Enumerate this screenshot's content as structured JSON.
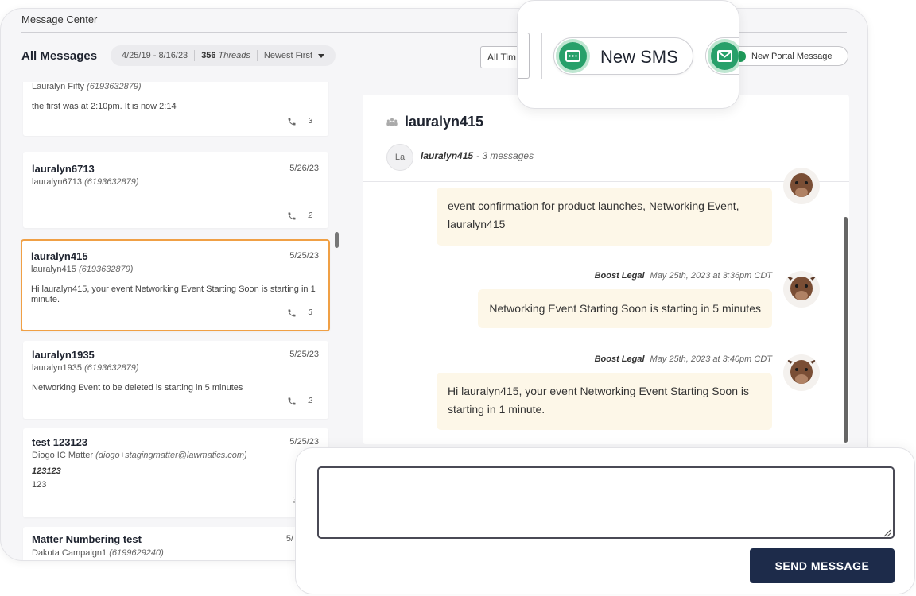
{
  "app": {
    "title": "Message Center"
  },
  "header": {
    "heading": "All Messages",
    "date_range": "4/25/19 - 8/16/23",
    "thread_count": "356",
    "thread_label": "Threads",
    "sort": "Newest First",
    "time_filter": "All Tim",
    "new_sms_label": "New SMS",
    "new_portal_label": "New Portal Message"
  },
  "threads": [
    {
      "name": "",
      "date": "",
      "sub_name": "Lauralyn Fifty",
      "sub_phone": "(6193632879)",
      "preview": "the first was at 2:10pm. It is now 2:14",
      "count": "3",
      "icon": "phone-icon"
    },
    {
      "name": "lauralyn6713",
      "date": "5/26/23",
      "sub_name": "lauralyn6713",
      "sub_phone": "(6193632879)",
      "preview": "",
      "count": "2",
      "icon": "phone-icon"
    },
    {
      "name": "lauralyn415",
      "date": "5/25/23",
      "sub_name": "lauralyn415",
      "sub_phone": "(6193632879)",
      "preview": "Hi lauralyn415, your event Networking Event Starting Soon is starting in 1 minute.",
      "count": "3",
      "icon": "phone-icon",
      "active": true
    },
    {
      "name": "lauralyn1935",
      "date": "5/25/23",
      "sub_name": "lauralyn1935",
      "sub_phone": "(6193632879)",
      "preview": "Networking Event to be deleted is starting in 5 minutes",
      "count": "2",
      "icon": "phone-icon"
    },
    {
      "name": "test 123123",
      "date": "5/25/23",
      "sub_name": "Diogo IC Matter",
      "sub_phone": "(diogo+stagingmatter@lawmatics.com)",
      "bold_line": "123123",
      "preview": "123",
      "count": "",
      "icon": "chat-icon"
    },
    {
      "name": "Matter Numbering test",
      "date": "5/",
      "sub_name": "Dakota Campaign1",
      "sub_phone": "(6199629240)",
      "preview": "",
      "count": "",
      "icon": ""
    }
  ],
  "conversation": {
    "title": "lauralyn415",
    "avatar_initials": "La",
    "contact": "lauralyn415",
    "message_count": "- 3 messages",
    "messages": [
      {
        "sender": "",
        "time": "",
        "text": "event confirmation for product launches, Networking Event, lauralyn415"
      },
      {
        "sender": "Boost Legal",
        "time": "May 25th, 2023 at 3:36pm CDT",
        "text": "Networking Event Starting Soon is starting in 5 minutes"
      },
      {
        "sender": "Boost Legal",
        "time": "May 25th, 2023 at 3:40pm CDT",
        "text": "Hi lauralyn415, your event Networking Event Starting Soon is starting in 1 minute."
      }
    ]
  },
  "compose": {
    "value": "",
    "send_label": "SEND MESSAGE"
  },
  "colors": {
    "accent_orange": "#f0a045",
    "sms_green": "#27a06a",
    "send_navy": "#1d2b4a",
    "bubble": "#fdf7e8"
  }
}
